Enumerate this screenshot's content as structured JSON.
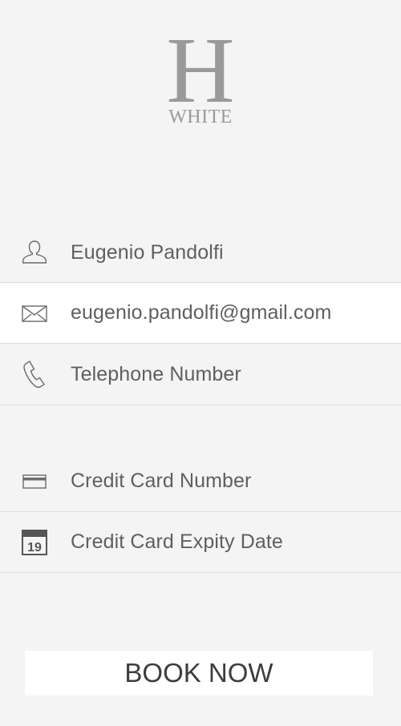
{
  "logo": {
    "mark": "H",
    "word": "WHITE"
  },
  "form": {
    "name": {
      "value": "Eugenio Pandolfi",
      "icon": "user-icon"
    },
    "email": {
      "value": "eugenio.pandolfi@gmail.com",
      "icon": "envelope-icon"
    },
    "phone": {
      "placeholder": "Telephone Number",
      "icon": "phone-icon"
    },
    "card": {
      "placeholder": "Credit Card Number",
      "icon": "credit-card-icon"
    },
    "expiry": {
      "placeholder": "Credit Card Expity Date",
      "icon": "calendar-icon",
      "icon_day": "19"
    }
  },
  "actions": {
    "book_label": "BOOK NOW"
  },
  "colors": {
    "background": "#f4f4f4",
    "active_row": "#ffffff",
    "text": "#5f5f5f",
    "logo": "#9a9a9a",
    "divider": "#dcdcdc"
  }
}
